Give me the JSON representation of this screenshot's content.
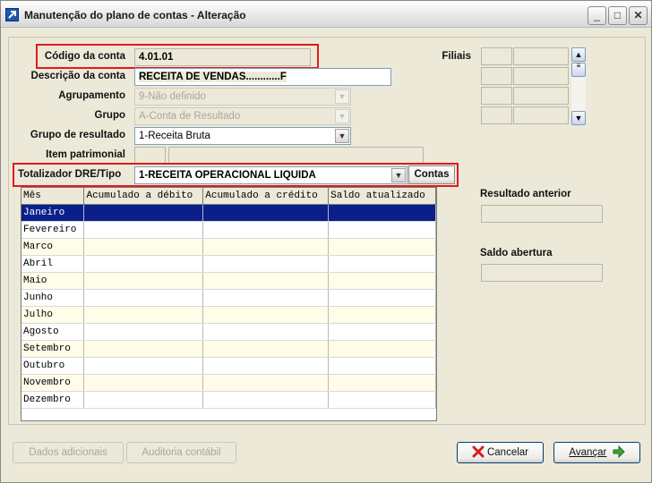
{
  "window": {
    "title": "Manutenção do plano de contas - Alteração",
    "minimize": "_",
    "maximize": "□",
    "close": "✕"
  },
  "form": {
    "codigo_label": "Código da conta",
    "codigo_value": "4.01.01",
    "descricao_label": "Descrição da conta",
    "descricao_value": "RECEITA DE VENDAS............F",
    "agrupamento_label": "Agrupamento",
    "agrupamento_value": "9-Não definido",
    "grupo_label": "Grupo",
    "grupo_value": "A-Conta de Resultado",
    "grupo_resultado_label": "Grupo de resultado",
    "grupo_resultado_value": "1-Receita Bruta",
    "item_patrimonial_label": "Item patrimonial",
    "item_patrimonial_code": "",
    "item_patrimonial_value": "",
    "totalizador_label": "Totalizador DRE/Tipo",
    "totalizador_value": "1-RECEITA OPERACIONAL LIQUIDA",
    "contas_button": "Contas"
  },
  "filiais": {
    "label": "Filiais"
  },
  "right_panel": {
    "resultado_anterior_label": "Resultado anterior",
    "resultado_anterior_value": "",
    "saldo_abertura_label": "Saldo abertura",
    "saldo_abertura_value": ""
  },
  "grid": {
    "columns": [
      "Mês",
      "Acumulado a débito",
      "Acumulado a crédito",
      "Saldo atualizado"
    ],
    "rows": [
      "Janeiro",
      "Fevereiro",
      "Marco",
      "Abril",
      "Maio",
      "Junho",
      "Julho",
      "Agosto",
      "Setembro",
      "Outubro",
      "Novembro",
      "Dezembro"
    ]
  },
  "buttons": {
    "dados_adicionais": "Dados adicionais",
    "auditoria": "Auditoria contábil",
    "cancelar": "Cancelar",
    "avancar": "Avançar"
  },
  "colors": {
    "highlight": "#e01b1b",
    "selection": "#0a1f8a",
    "alt_row": "#FFFDE8"
  }
}
